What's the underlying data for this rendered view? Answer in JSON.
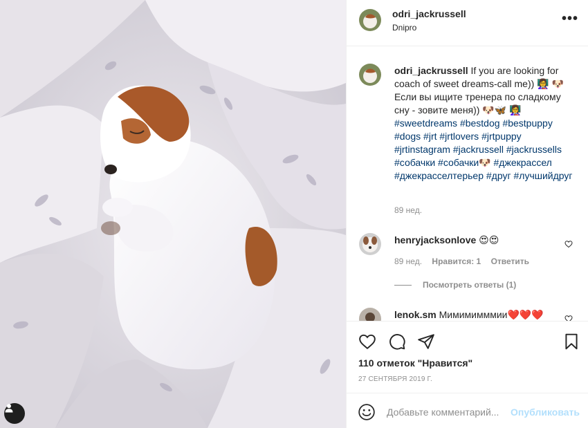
{
  "header": {
    "username": "odri_jackrussell",
    "location": "Dnipro",
    "more_label": "•••"
  },
  "caption": {
    "username": "odri_jackrussell",
    "text": "If you are looking for coach of sweet dreams-call me)) 👩‍🏫 🐶 Если вы ищите тренера по сладкому сну - зовите меня)) 🐶🦋 👩‍🏫",
    "hashtags": [
      "#sweetdreams",
      "#bestdog",
      "#bestpuppy",
      "#dogs",
      "#jrt",
      "#jrtlovers",
      "#jrtpuppy",
      "#jrtinstagram",
      "#jackrussell",
      "#jackrussells",
      "#собачки",
      "#собачки🐶",
      "#джекрассел",
      "#джекрасселтерьер",
      "#друг",
      "#лучшийдруг"
    ],
    "time": "89 нед."
  },
  "comments": [
    {
      "username": "henryjacksonlove",
      "text": "😍😍",
      "time": "89 нед.",
      "likes": "Нравится: 1",
      "reply_label": "Ответить",
      "view_replies": "Посмотреть ответы (1)"
    },
    {
      "username": "lenok.sm",
      "text": "Мимимимммии❤️❤️❤️"
    }
  ],
  "actions": {
    "likes_text": "110 отметок \"Нравится\"",
    "date": "27 СЕНТЯБРЯ 2019 Г."
  },
  "add_comment": {
    "placeholder": "Добавьте комментарий...",
    "post_label": "Опубликовать"
  },
  "icons": {
    "like": "heart-icon",
    "comment": "comment-icon",
    "share": "paper-plane-icon",
    "save": "bookmark-icon",
    "emoji": "smiley-icon",
    "tag": "user-tag-icon"
  },
  "colors": {
    "hashtag": "#00376b",
    "secondary_text": "#8e8e8e",
    "post_button_disabled": "#b2dffc",
    "divider": "#efefef"
  }
}
